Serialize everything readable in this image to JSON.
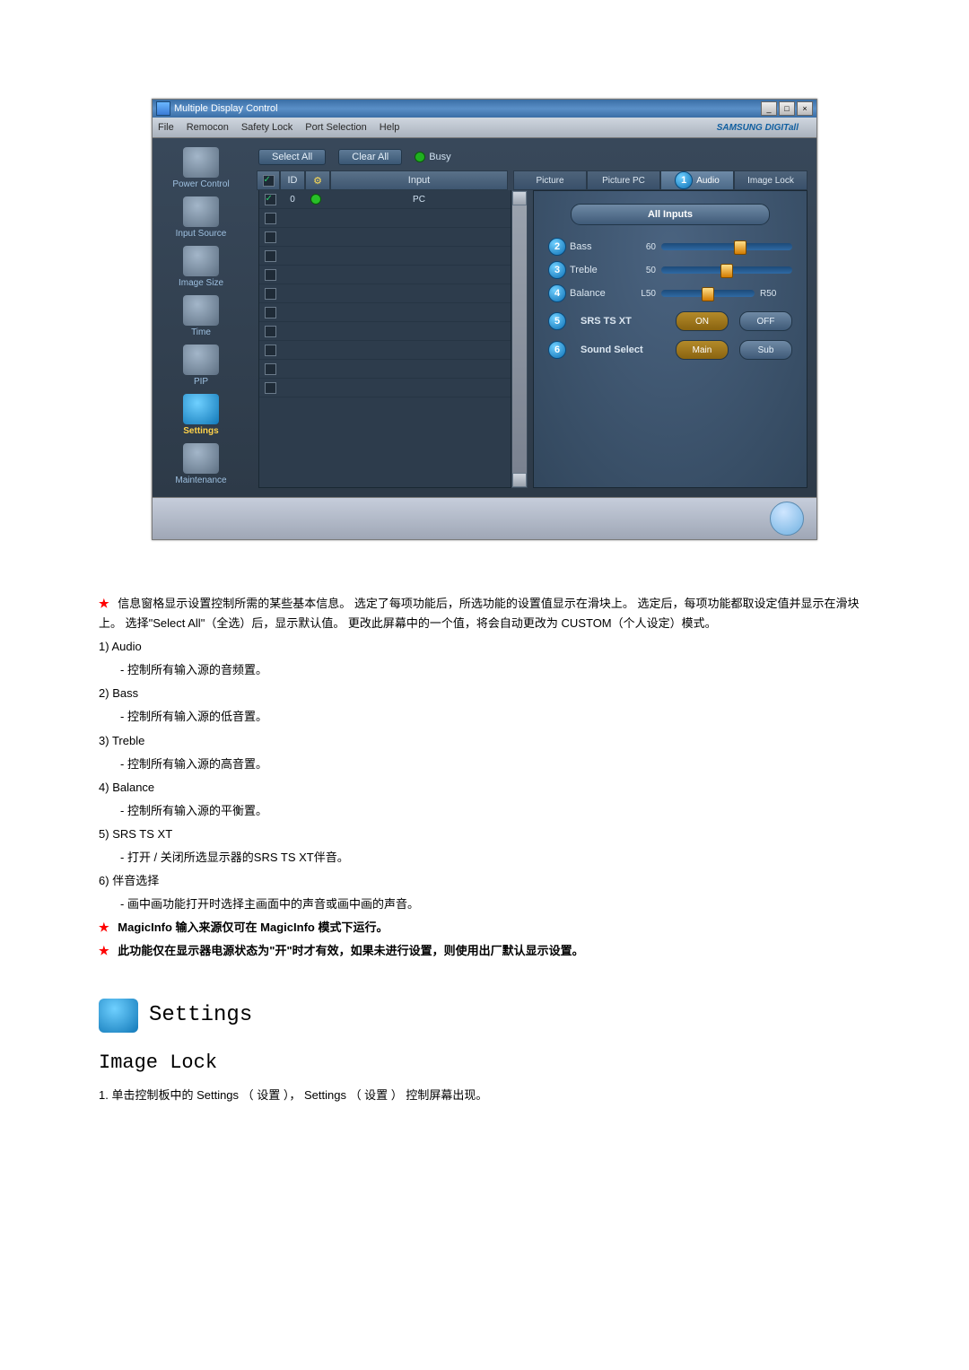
{
  "app": {
    "title": "Multiple Display Control",
    "menus": [
      "File",
      "Remocon",
      "Safety Lock",
      "Port Selection",
      "Help"
    ],
    "brand": "SAMSUNG DIGITall",
    "toolbar": {
      "select_all": "Select All",
      "clear_all": "Clear All",
      "busy": "Busy"
    },
    "sidebar": [
      {
        "label": "Power Control"
      },
      {
        "label": "Input Source"
      },
      {
        "label": "Image Size"
      },
      {
        "label": "Time"
      },
      {
        "label": "PIP"
      },
      {
        "label": "Settings",
        "active": true
      },
      {
        "label": "Maintenance"
      }
    ],
    "grid_headers": {
      "id": "ID",
      "input": "Input"
    },
    "grid_rows": [
      {
        "checked": true,
        "id": "0",
        "status": "on",
        "input": "PC"
      },
      {
        "checked": false
      },
      {
        "checked": false
      },
      {
        "checked": false
      },
      {
        "checked": false
      },
      {
        "checked": false
      },
      {
        "checked": false
      },
      {
        "checked": false
      },
      {
        "checked": false
      },
      {
        "checked": false
      },
      {
        "checked": false
      }
    ],
    "tabs": {
      "picture": "Picture",
      "picture_pc": "Picture PC",
      "audio": "Audio",
      "image_lock": "Image Lock",
      "badge1": "1"
    },
    "panel": {
      "dropdown": "All Inputs",
      "sliders": {
        "bass": {
          "badge": "2",
          "label": "Bass",
          "value": "60",
          "pct": 60
        },
        "treble": {
          "badge": "3",
          "label": "Treble",
          "value": "50",
          "pct": 50
        },
        "balance": {
          "badge": "4",
          "label": "Balance",
          "value": "L50",
          "right": "R50",
          "pct": 50
        }
      },
      "srs": {
        "badge": "5",
        "label": "SRS TS XT",
        "on": "ON",
        "off": "OFF"
      },
      "sound_select": {
        "badge": "6",
        "label": "Sound Select",
        "main": "Main",
        "sub": "Sub"
      }
    }
  },
  "doc": {
    "intro": "信息窗格显示设置控制所需的某些基本信息。 选定了每项功能后，所选功能的设置值显示在滑块上。 选定后，每项功能都取设定值并显示在滑块上。 选择\"Select All\"（全选）后，显示默认值。 更改此屏幕中的一个值，将会自动更改为 CUSTOM（个人设定）模式。",
    "items": [
      {
        "no": "1)",
        "title": "Audio",
        "desc": "- 控制所有输入源的音频置。"
      },
      {
        "no": "2)",
        "title": "Bass",
        "desc": "- 控制所有输入源的低音置。"
      },
      {
        "no": "3)",
        "title": "Treble",
        "desc": "- 控制所有输入源的高音置。"
      },
      {
        "no": "4)",
        "title": "Balance",
        "desc": "- 控制所有输入源的平衡置。"
      },
      {
        "no": "5)",
        "title": "SRS TS XT",
        "desc": "- 打开 / 关闭所选显示器的SRS TS XT伴音。"
      },
      {
        "no": "6)",
        "title": "伴音选择",
        "desc": "- 画中画功能打开时选择主画面中的声音或画中画的声音。"
      }
    ],
    "note1": "MagicInfo 输入来源仅可在 MagicInfo 模式下运行。",
    "note2": "此功能仅在显示器电源状态为\"开\"时才有效，如果未进行设置，则使用出厂默认显示设置。",
    "section_title": "Settings",
    "subsection": "Image Lock",
    "sub_desc": "1. 单击控制板中的 Settings （ 设置 ）， Settings （ 设置 ） 控制屏幕出现。"
  }
}
